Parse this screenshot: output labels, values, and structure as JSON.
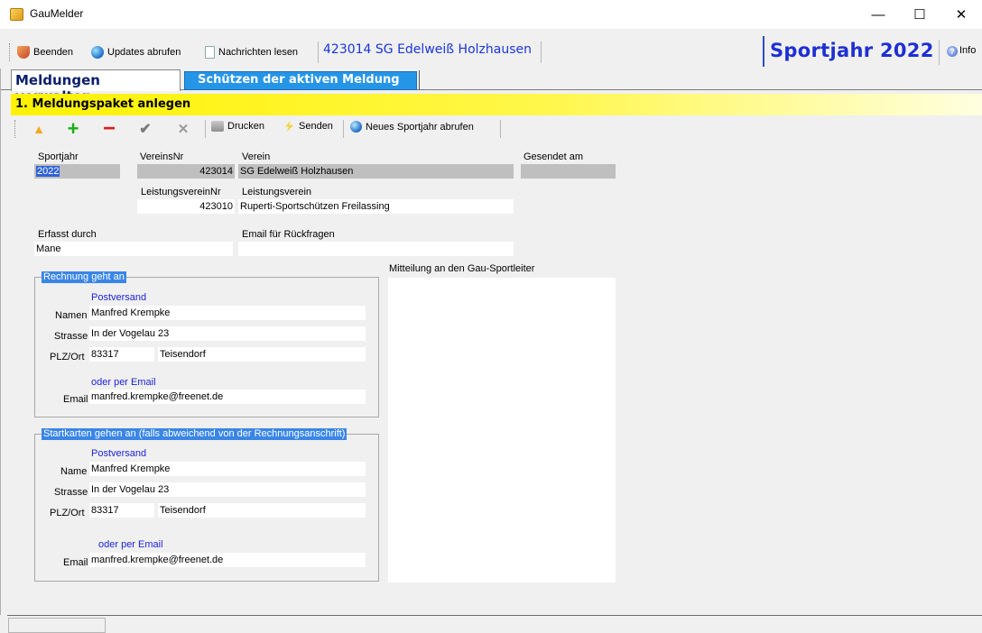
{
  "window": {
    "title": "GauMelder",
    "minimize": "—",
    "maximize": "☐",
    "close": "✕"
  },
  "toolbar": {
    "beenden": "Beenden",
    "updates": "Updates abrufen",
    "nachrichten": "Nachrichten lesen",
    "verein_banner": "423014  SG Edelweiß Holzhausen",
    "sportjahr": "Sportjahr 2022",
    "info": "Info"
  },
  "tabs": [
    {
      "label": "Meldungen verwalten",
      "active": true
    },
    {
      "label": "Schützen der aktiven Meldung",
      "active": false
    }
  ],
  "section": {
    "title": "1. Meldungspaket anlegen"
  },
  "actions": {
    "up": "▲",
    "add": "+",
    "remove": "−",
    "confirm": "✔",
    "cancel": "✕",
    "drucken": "Drucken",
    "senden": "Senden",
    "neues_sportjahr": "Neues Sportjahr abrufen"
  },
  "form": {
    "sportjahr_label": "Sportjahr",
    "sportjahr_value": "2022",
    "vereinsnr_label": "VereinsNr",
    "vereinsnr_value": "423014",
    "verein_label": "Verein",
    "verein_value": "SG Edelweiß Holzhausen",
    "gesendet_label": "Gesendet am",
    "gesendet_value": "",
    "leistungsvereinnr_label": "LeistungsvereinNr",
    "leistungsvereinnr_value": "423010",
    "leistungsverein_label": "Leistungsverein",
    "leistungsverein_value": "Ruperti-Sportschützen Freilassing",
    "erfasst_label": "Erfasst durch",
    "erfasst_value": "Mane",
    "email_rueck_label": "Email für Rückfragen",
    "email_rueck_value": "",
    "mitteilung_label": "Mitteilung an den Gau-Sportleiter",
    "mitteilung_value": ""
  },
  "rechnung": {
    "legend": "Rechnung geht an",
    "postversand": "Postversand",
    "namen_label": "Namen",
    "namen_value": "Manfred Krempke",
    "strasse_label": "Strasse",
    "strasse_value": "In der Vogelau 23",
    "plzort_label": "PLZ/Ort",
    "plz_value": "83317",
    "ort_value": "Teisendorf",
    "oder_email": "oder per Email",
    "email_label": "Email",
    "email_value": "manfred.krempke@freenet.de"
  },
  "startkarten": {
    "legend": "Startkarten gehen an (falls abweichend von der Rechnungsanschrift)",
    "postversand": "Postversand",
    "name_label": "Name",
    "name_value": "Manfred Krempke",
    "strasse_label": "Strasse",
    "strasse_value": "In der Vogelau 23",
    "plzort_label": "PLZ/Ort",
    "plz_value": "83317",
    "ort_value": "Teisendorf",
    "oder_email": "oder per Email",
    "email_label": "Email",
    "email_value": "manfred.krempke@freenet.de"
  }
}
